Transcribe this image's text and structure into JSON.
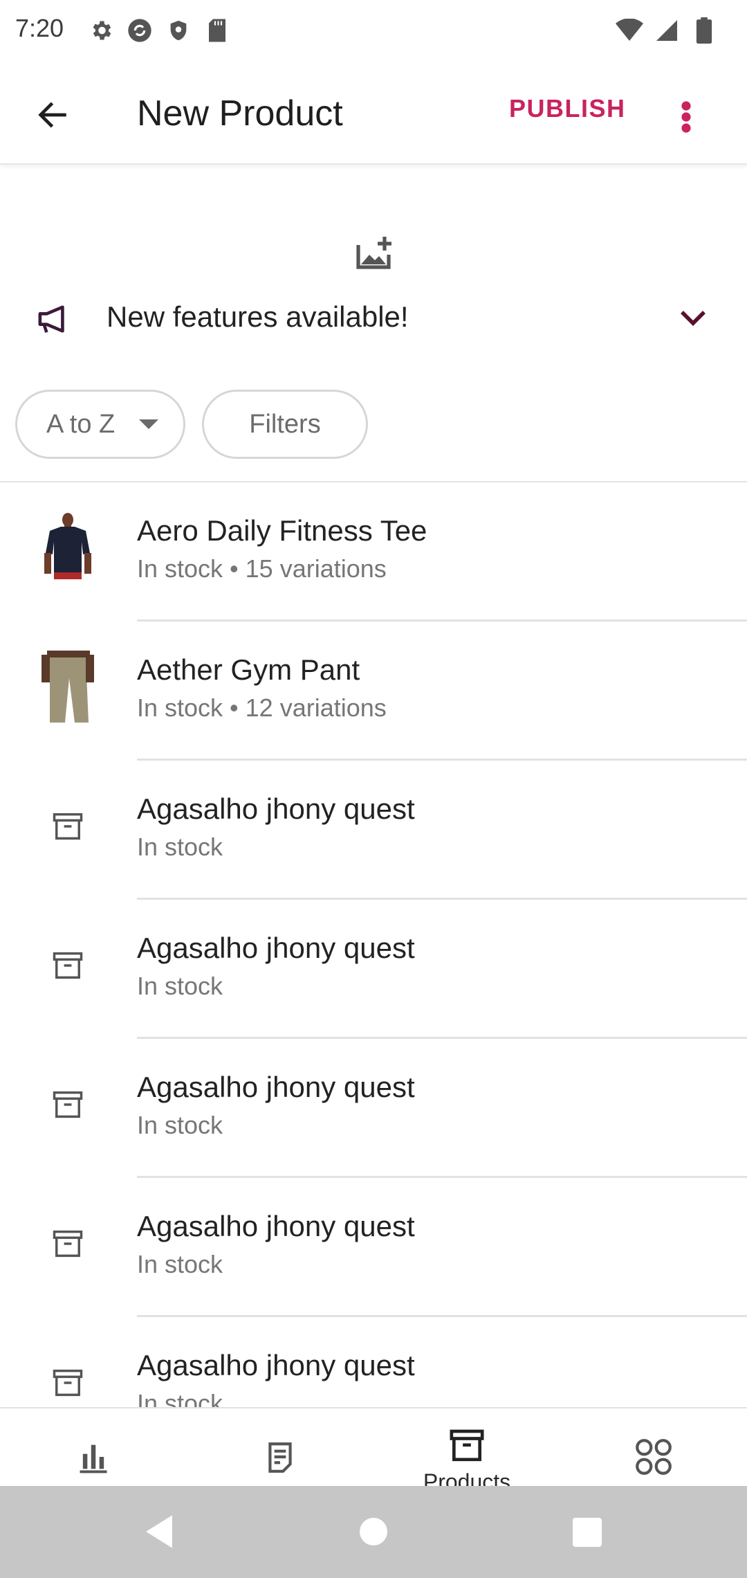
{
  "status_bar": {
    "time": "7:20",
    "left_icons": [
      "settings-icon",
      "sync-icon",
      "shield-icon",
      "sd-card-icon"
    ],
    "right_icons": [
      "wifi-icon",
      "signal-icon",
      "battery-icon"
    ]
  },
  "app_bar": {
    "title": "New Product",
    "publish_label": "PUBLISH",
    "accent_color": "#c9235f"
  },
  "feature_banner": {
    "text": "New features available!"
  },
  "chips": {
    "sort_label": "A to Z",
    "filters_label": "Filters"
  },
  "products": [
    {
      "name": "Aero Daily Fitness Tee",
      "status": "In stock • 15 variations",
      "thumb": "tee-photo"
    },
    {
      "name": "Aether Gym Pant",
      "status": "In stock • 12 variations",
      "thumb": "pant-photo"
    },
    {
      "name": "Agasalho jhony quest",
      "status": "In stock",
      "thumb": "archive-icon"
    },
    {
      "name": "Agasalho jhony quest",
      "status": "In stock",
      "thumb": "archive-icon"
    },
    {
      "name": "Agasalho jhony quest",
      "status": "In stock",
      "thumb": "archive-icon"
    },
    {
      "name": "Agasalho jhony quest",
      "status": "In stock",
      "thumb": "archive-icon"
    },
    {
      "name": "Agasalho jhony quest",
      "status": "In stock",
      "thumb": "archive-icon"
    }
  ],
  "bottom_nav": {
    "items": [
      {
        "label": "",
        "icon": "bar-chart-icon"
      },
      {
        "label": "",
        "icon": "orders-icon"
      },
      {
        "label": "Products",
        "icon": "archive-icon",
        "active": true
      },
      {
        "label": "",
        "icon": "more-grid-icon"
      }
    ]
  }
}
